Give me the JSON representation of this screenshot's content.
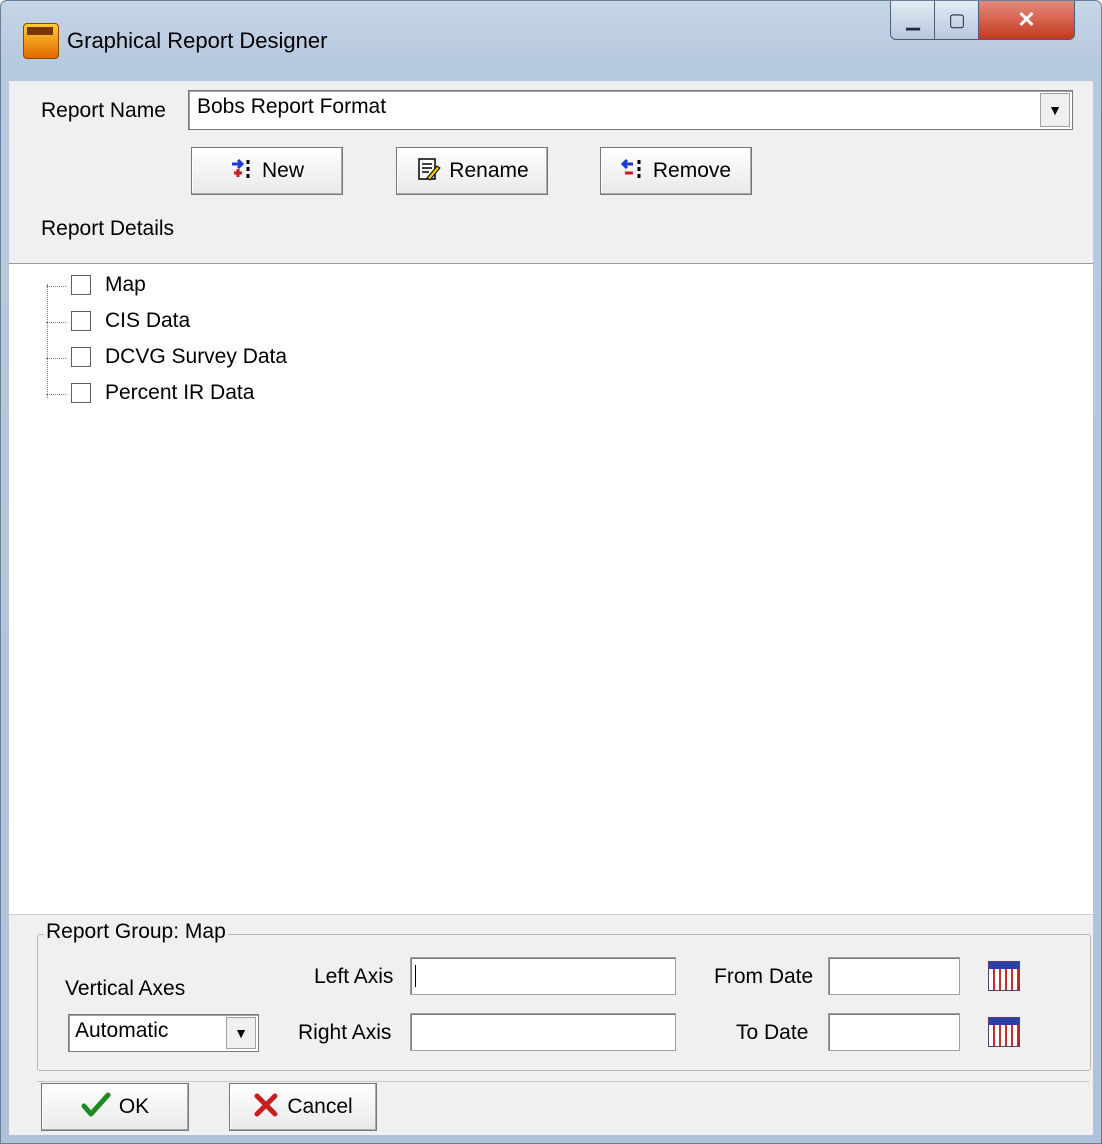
{
  "window": {
    "title": "Graphical Report Designer",
    "minimize": "▁",
    "maximize": "▢",
    "close": "✕"
  },
  "report_name": {
    "label": "Report Name",
    "value": "Bobs Report Format",
    "arrow": "▼"
  },
  "toolbar": {
    "new_label": "New",
    "rename_label": "Rename",
    "remove_label": "Remove"
  },
  "report_details": {
    "label": "Report Details",
    "items": [
      "Map",
      "CIS Data",
      "DCVG Survey Data",
      "Percent IR Data"
    ]
  },
  "report_group": {
    "title": "Report Group:  Map",
    "vertical_axes_label": "Vertical Axes",
    "vertical_axes_value": "Automatic",
    "left_axis_label": "Left Axis",
    "left_axis_value": "",
    "right_axis_label": "Right Axis",
    "right_axis_value": "",
    "from_date_label": "From Date",
    "from_date_value": "",
    "to_date_label": "To Date",
    "to_date_value": ""
  },
  "footer": {
    "ok_label": "OK",
    "cancel_label": "Cancel"
  }
}
